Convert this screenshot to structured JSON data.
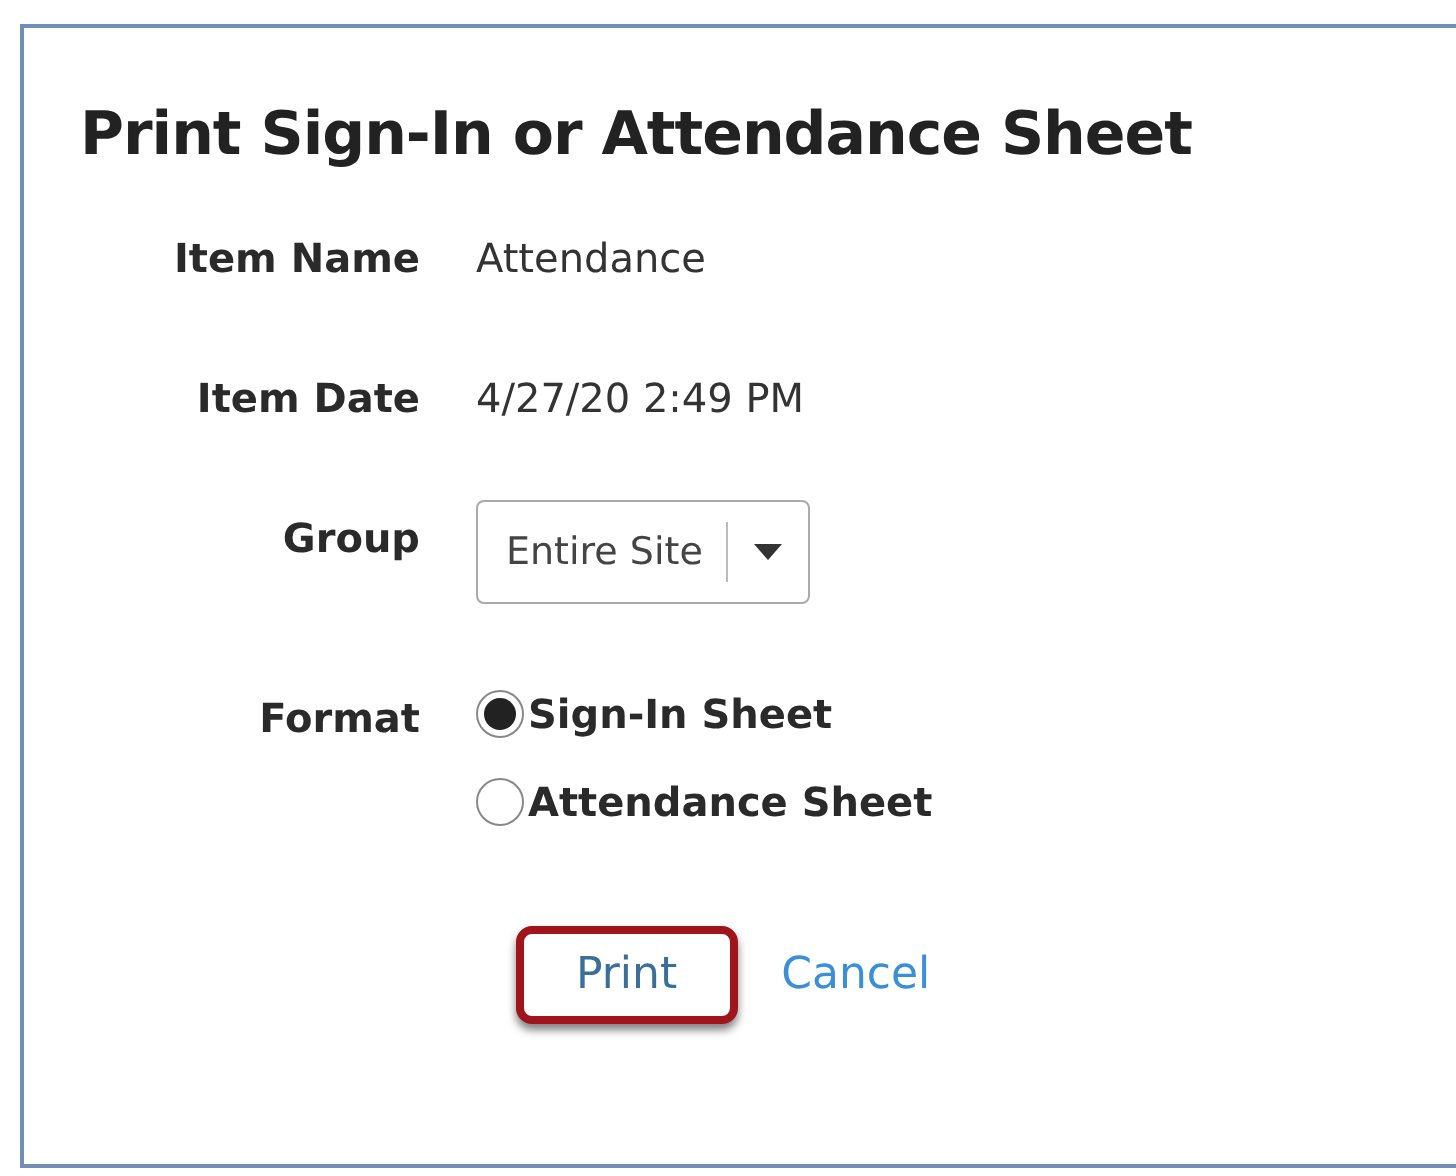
{
  "dialog": {
    "title": "Print Sign-In or Attendance Sheet"
  },
  "fields": [
    {
      "label": "Item Name",
      "value": "Attendance"
    },
    {
      "label": "Item Date",
      "value": "4/27/20 2:49 PM"
    }
  ],
  "group": {
    "label": "Group",
    "value": "Entire Site"
  },
  "format": {
    "label": "Format",
    "options": [
      {
        "label": "Sign-In Sheet",
        "selected": true
      },
      {
        "label": "Attendance Sheet",
        "selected": false
      }
    ]
  },
  "buttons": {
    "print": {
      "label": "Print",
      "highlighted": true
    },
    "cancel": {
      "label": "Cancel"
    }
  }
}
